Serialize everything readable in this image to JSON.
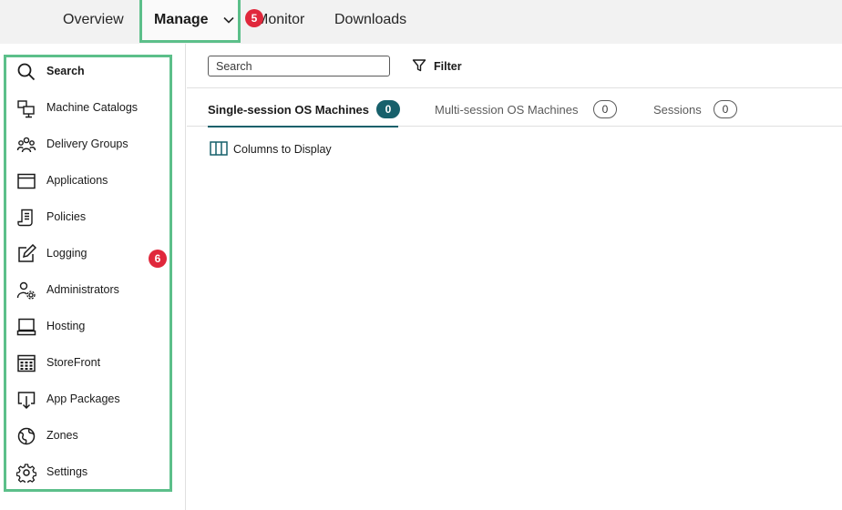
{
  "topnav": {
    "items": [
      "Overview",
      "Manage",
      "Monitor",
      "Downloads"
    ],
    "active": "Manage"
  },
  "callouts": {
    "manage": "5",
    "sidebar": "6"
  },
  "sidebar": {
    "items": [
      {
        "label": "Search",
        "icon": "search-icon",
        "active": true
      },
      {
        "label": "Machine Catalogs",
        "icon": "machine-catalogs-icon"
      },
      {
        "label": "Delivery Groups",
        "icon": "delivery-groups-icon"
      },
      {
        "label": "Applications",
        "icon": "applications-icon"
      },
      {
        "label": "Policies",
        "icon": "policies-icon"
      },
      {
        "label": "Logging",
        "icon": "logging-icon"
      },
      {
        "label": "Administrators",
        "icon": "administrators-icon"
      },
      {
        "label": "Hosting",
        "icon": "hosting-icon"
      },
      {
        "label": "StoreFront",
        "icon": "storefront-icon"
      },
      {
        "label": "App Packages",
        "icon": "app-packages-icon"
      },
      {
        "label": "Zones",
        "icon": "zones-icon"
      },
      {
        "label": "Settings",
        "icon": "gear-icon"
      }
    ]
  },
  "toolbar": {
    "search_placeholder": "Search",
    "filter_label": "Filter"
  },
  "tabs": [
    {
      "label": "Single-session OS Machines",
      "count": "0",
      "active": true
    },
    {
      "label": "Multi-session OS Machines",
      "count": "0"
    },
    {
      "label": "Sessions",
      "count": "0"
    }
  ],
  "columns_button": "Columns to Display",
  "colors": {
    "accent": "#17606b",
    "highlight_border": "#5cbf8a",
    "callout": "#e0283c"
  }
}
